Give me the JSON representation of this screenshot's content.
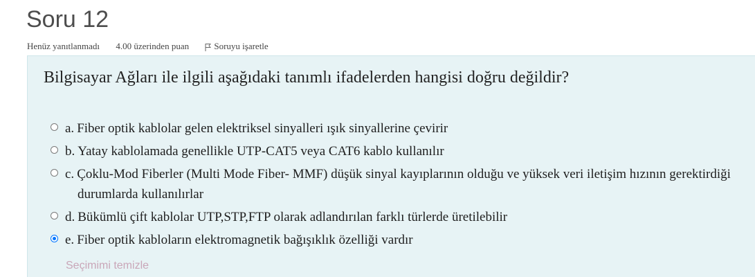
{
  "question": {
    "title": "Soru 12",
    "state": "Henüz yanıtlanmadı",
    "grade": "4.00 üzerinden puan",
    "flag_label": "Soruyu işaretle",
    "flag_icon": "flag-icon",
    "text": "Bilgisayar Ağları ile ilgili aşağıdaki tanımlı ifadelerden hangisi doğru değildir?",
    "answers": [
      {
        "letter": "a.",
        "text": "Fiber optik kablolar gelen elektriksel sinyalleri ışık sinyallerine çevirir",
        "selected": false
      },
      {
        "letter": "b.",
        "text": "Yatay kablolamada genellikle UTP-CAT5 veya CAT6 kablo kullanılır",
        "selected": false
      },
      {
        "letter": "c.",
        "text": "Çoklu-Mod Fiberler (Multi Mode Fiber- MMF) düşük sinyal kayıplarının olduğu ve yüksek veri iletişim hızının gerektirdiği durumlarda kullanılırlar",
        "selected": false
      },
      {
        "letter": "d.",
        "text": "Bükümlü çift kablolar UTP,STP,FTP olarak adlandırılan farklı türlerde üretilebilir",
        "selected": false
      },
      {
        "letter": "e.",
        "text": "Fiber optik kabloların elektromagnetik bağışıklık özelliği vardır",
        "selected": true
      }
    ],
    "clear_choice": "Seçimimi temizle"
  },
  "colors": {
    "panel_bg": "#e7f3f5",
    "radio_checked": "#0075ff",
    "clear_link": "#c9a6b8"
  }
}
